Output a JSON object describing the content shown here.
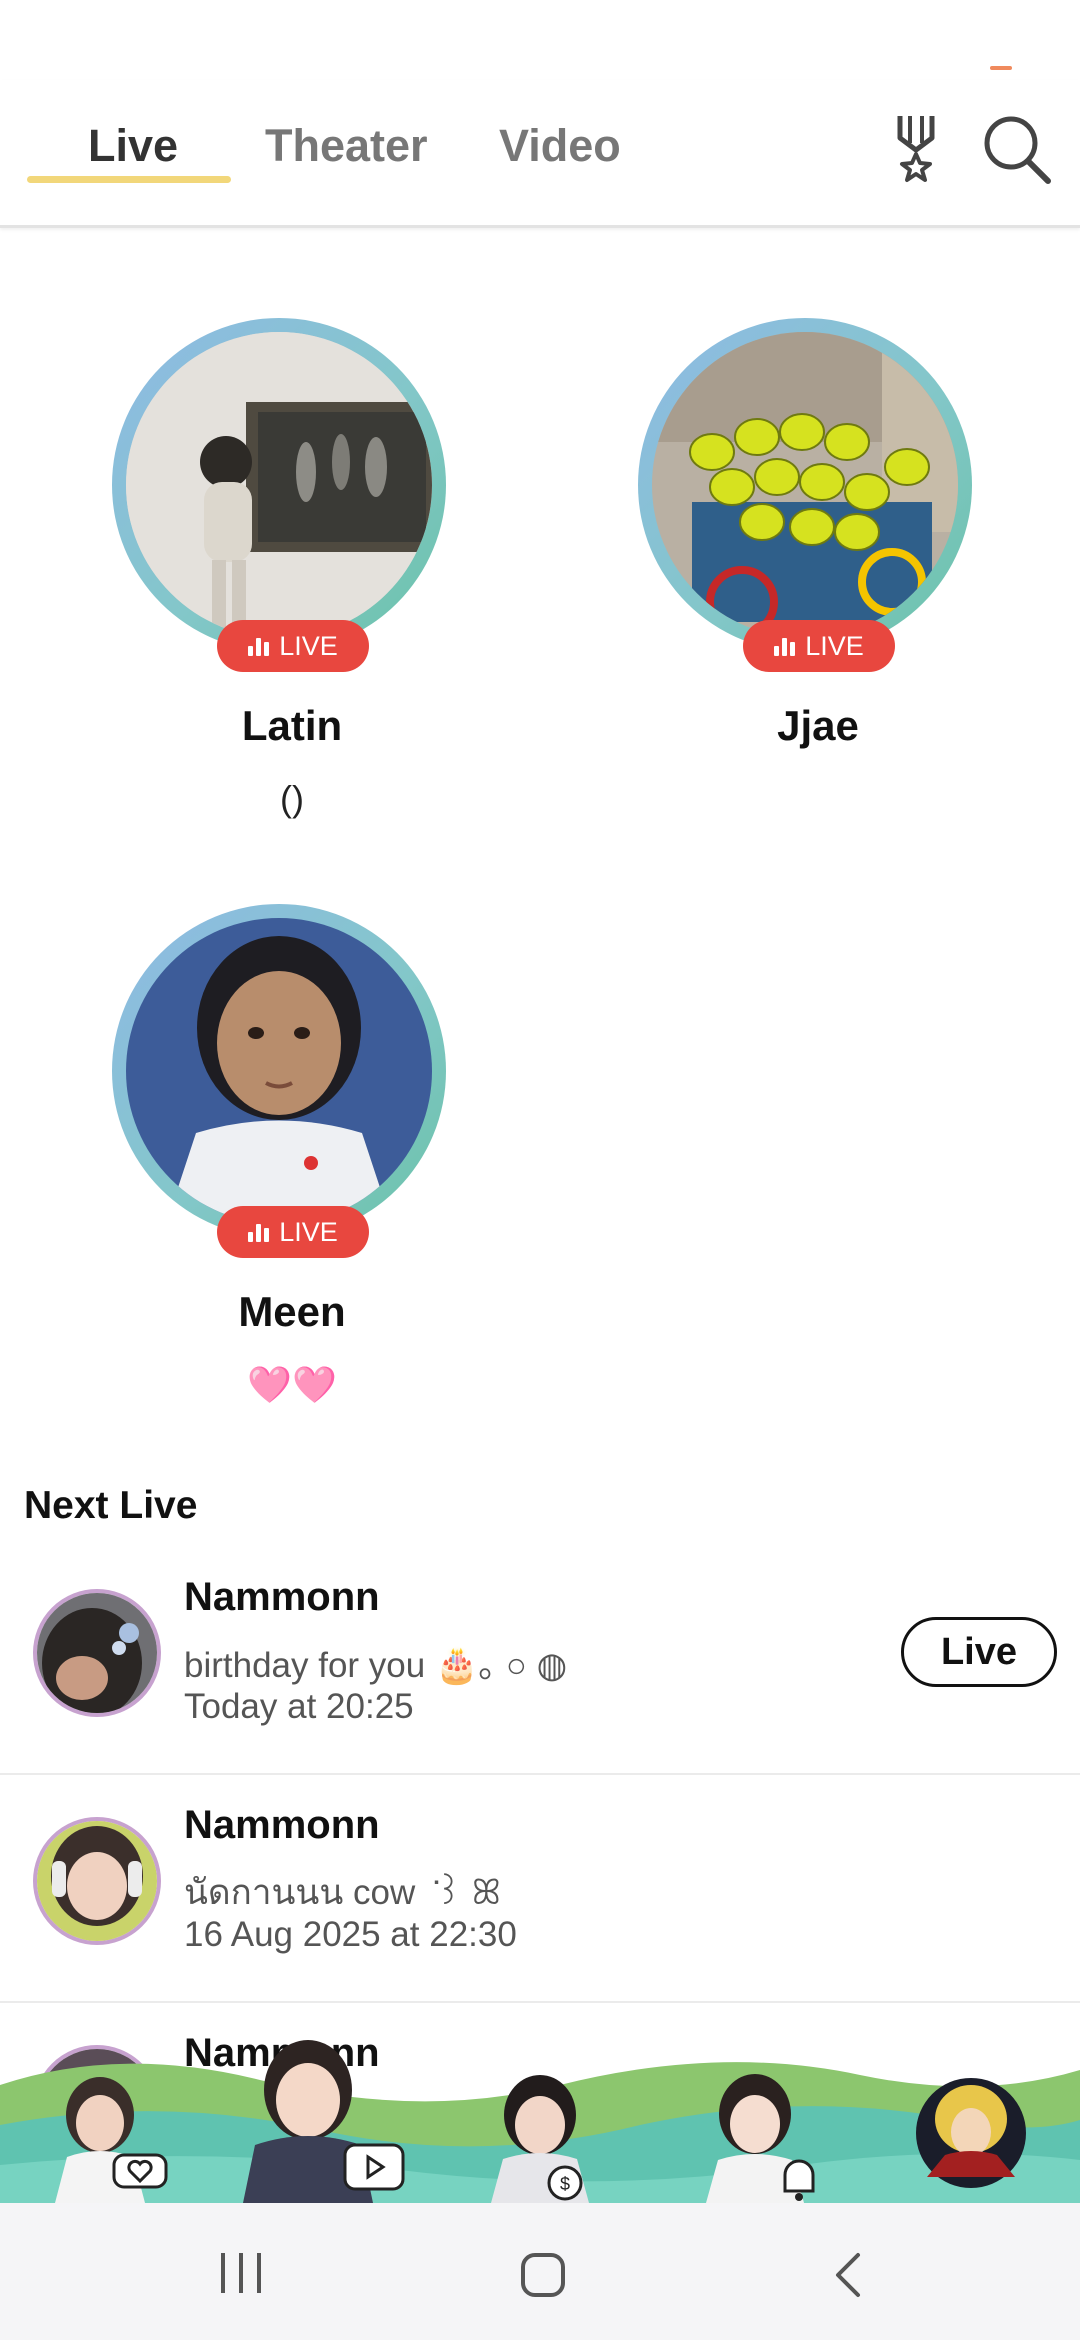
{
  "tabs": [
    {
      "label": "Live",
      "active": true
    },
    {
      "label": "Theater",
      "active": false
    },
    {
      "label": "Video",
      "active": false
    }
  ],
  "header_icons": [
    "medal-star-icon",
    "search-icon"
  ],
  "live_badge_label": "LIVE",
  "live_cards": [
    {
      "name": "Latin",
      "subtitle": "()"
    },
    {
      "name": "Jjae",
      "subtitle": ""
    },
    {
      "name": "Meen",
      "subtitle": "🩷🩷"
    }
  ],
  "next_live": {
    "title": "Next Live",
    "items": [
      {
        "name": "Nammonn",
        "description": "birthday for you 🎂｡ ○ ◍",
        "time": "Today at 20:25",
        "button": "Live"
      },
      {
        "name": "Nammonn",
        "description": "นัดกานนน cow ݁ ꒱ ꕤ",
        "time": "16 Aug 2025 at 22:30"
      },
      {
        "name": "Nammonn",
        "description": "",
        "time": ""
      }
    ]
  },
  "banner_icons": [
    "heart-icon",
    "play-icon",
    "coin-icon",
    "bell-icon"
  ],
  "nav_icons": [
    "recent-apps-icon",
    "home-icon",
    "back-icon"
  ],
  "colors": {
    "accent_underline": "#f2d77a",
    "live_badge": "#e8473f",
    "ring_start": "#8fb9e6",
    "ring_end": "#6ac2a8",
    "banner_green": "#8cc66e",
    "banner_teal": "#5fc3b0"
  }
}
